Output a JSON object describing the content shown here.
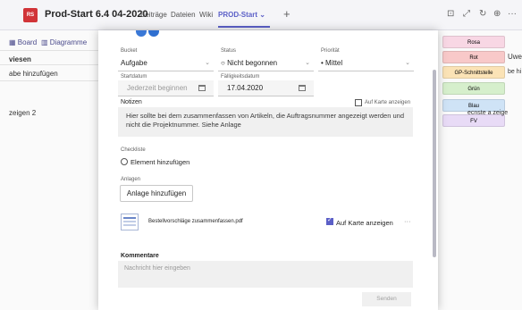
{
  "header": {
    "team_badge": "RS",
    "title": "Prod-Start 6.4 04-2020",
    "tabs": [
      {
        "label": "Beiträge"
      },
      {
        "label": "Dateien"
      },
      {
        "label": "Wiki"
      },
      {
        "label": "PROD-Start ⌄"
      }
    ],
    "add_tab": "+",
    "icons": [
      "expand-icon",
      "popout-icon",
      "refresh-icon",
      "globe-icon",
      "more-icon"
    ]
  },
  "planner": {
    "board_label": "Board",
    "charts_label": "Diagramme",
    "column_header": "viesen",
    "add_task": "abe hinzufügen",
    "show_count": "zeigen  2"
  },
  "labels": {
    "items": [
      {
        "name": "Rosa",
        "color": "#f8d7e4"
      },
      {
        "name": "Rot",
        "color": "#f8c9c9"
      },
      {
        "name": "GP-Schnittstelle",
        "color": "#fbe3b6"
      },
      {
        "name": "Grün",
        "color": "#d6efcc"
      },
      {
        "name": "Blau",
        "color": "#cfe3f6"
      },
      {
        "name": "FV",
        "color": "#e8dbf6"
      }
    ],
    "user_name": "Uwe",
    "right_fragment_1": "be hi",
    "right_fragment_2": "ecnste a zeige"
  },
  "task": {
    "bucket_label": "Bucket",
    "bucket_value": "Aufgabe",
    "status_label": "Status",
    "status_value": "Nicht begonnen",
    "priority_label": "Priorität",
    "priority_value": "Mittel",
    "start_label": "Startdatum",
    "start_placeholder": "Jederzeit beginnen",
    "due_label": "Fälligkeitsdatum",
    "due_value": "17.04.2020",
    "notes_label": "Notizen",
    "show_on_card": "Auf Karte anzeigen",
    "notes_text": "Hier sollte bei dem zusammenfassen von Artikeln, die Auftragsnummer angezeigt werden und nicht die Projektnummer. Siehe Anlage",
    "checklist_label": "Checkliste",
    "checklist_add": "Element hinzufügen",
    "attachments_label": "Anlagen",
    "attachments_add": "Anlage hinzufügen",
    "attachment_name": "Bestellvorschläge zusammenfassen.pdf",
    "attachment_show_on_card": "Auf Karte anzeigen",
    "attachment_more": "···",
    "comments_label": "Kommentare",
    "comment_placeholder": "Nachricht hier eingeben",
    "send_label": "Senden"
  },
  "colors": {
    "accent": "#5b5fc7",
    "badge": "#d13438"
  }
}
